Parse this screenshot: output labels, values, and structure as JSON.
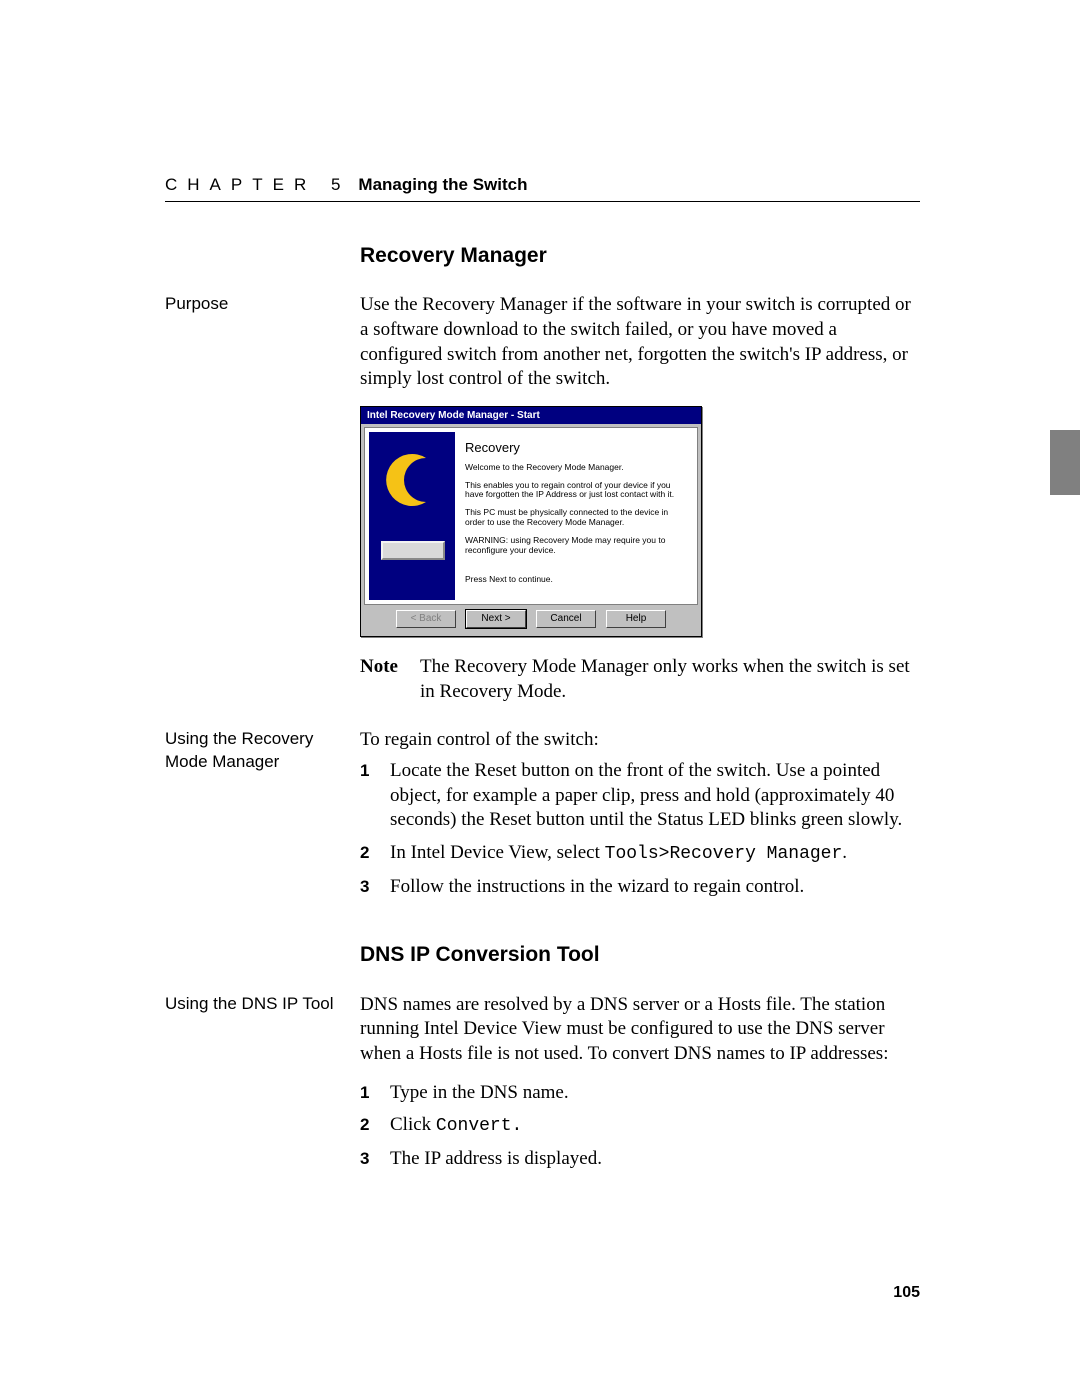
{
  "header": {
    "chapter": "CHAPTER 5",
    "title": "Managing the Switch"
  },
  "thumb_tab": "",
  "sections": {
    "recovery": {
      "heading": "Recovery Manager",
      "purpose_label": "Purpose",
      "purpose_text": "Use the Recovery Manager if the software in your switch is corrupted or a software download to the switch failed, or you have moved a configured switch from another net, forgotten the switch's IP address, or simply lost control of the switch.",
      "note_label": "Note",
      "note_text": "The Recovery Mode Manager only works when the switch is set in Recovery Mode.",
      "using_label": "Using the Recovery Mode Manager",
      "using_intro": "To regain control of the switch:",
      "steps": [
        "Locate the Reset button on the front of the switch. Use a pointed object, for example a paper clip, press and hold (approximately 40 seconds) the Reset button until the Status LED blinks green slowly.",
        "In Intel Device View, select ",
        "Follow the instructions in the wizard to regain control."
      ],
      "step2_mono": "Tools>Recovery Manager",
      "step2_suffix": "."
    },
    "dns": {
      "heading": "DNS IP Conversion Tool",
      "using_label": "Using the DNS IP Tool",
      "intro": "DNS names are resolved by a DNS server or a Hosts file. The station running Intel Device View must be configured to use the DNS server when a Hosts file is not used. To convert DNS names to IP addresses:",
      "steps_prefix": [
        "Type in the DNS name.",
        "Click ",
        "The IP address is displayed."
      ],
      "step2_mono": "Convert.",
      "step2_suffix": ""
    }
  },
  "dialog": {
    "title": "Intel Recovery Mode Manager - Start",
    "heading": "Recovery",
    "p1": "Welcome to the Recovery Mode Manager.",
    "p2": "This enables you to regain control of your device if you have forgotten the IP Address or just lost contact with it.",
    "p3": "This PC must be physically connected to the device in order to use  the Recovery Mode Manager.",
    "p4": "WARNING: using Recovery Mode may require you to reconfigure your device.",
    "p5": "Press Next to continue.",
    "buttons": {
      "back": "< Back",
      "next": "Next >",
      "cancel": "Cancel",
      "help": "Help"
    }
  },
  "page_number": "105"
}
